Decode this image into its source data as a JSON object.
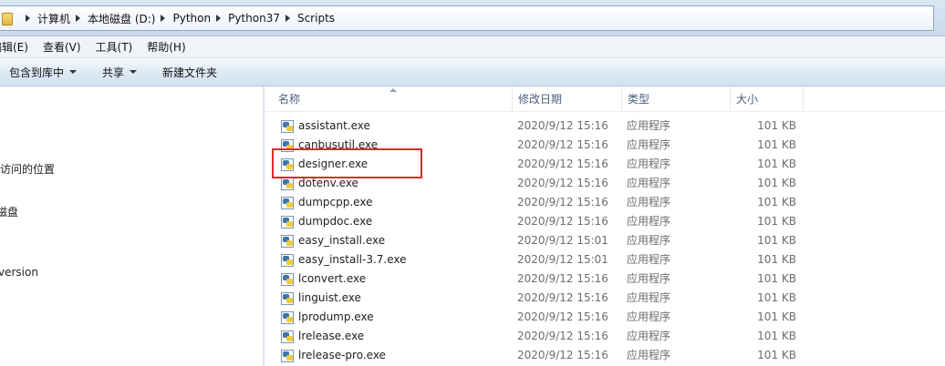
{
  "address": {
    "crumbs": [
      "计算机",
      "本地磁盘 (D:)",
      "Python",
      "Python37",
      "Scripts"
    ]
  },
  "menu": [
    "编辑(E)",
    "查看(V)",
    "工具(T)",
    "帮助(H)"
  ],
  "toolbar": {
    "include_library": "包含到库中",
    "share": "共享",
    "new_folder": "新建文件夹"
  },
  "nav": {
    "items": [
      "≡",
      "访问的位置",
      "磁盘",
      "version"
    ]
  },
  "columns": {
    "name": "名称",
    "date": "修改日期",
    "type": "类型",
    "size": "大小"
  },
  "files": [
    {
      "name": "assistant.exe",
      "date": "2020/9/12 15:16",
      "type": "应用程序",
      "size": "101 KB"
    },
    {
      "name": "canbusutil.exe",
      "date": "2020/9/12 15:16",
      "type": "应用程序",
      "size": "101 KB"
    },
    {
      "name": "designer.exe",
      "date": "2020/9/12 15:16",
      "type": "应用程序",
      "size": "101 KB"
    },
    {
      "name": "dotenv.exe",
      "date": "2020/9/12 15:16",
      "type": "应用程序",
      "size": "101 KB"
    },
    {
      "name": "dumpcpp.exe",
      "date": "2020/9/12 15:16",
      "type": "应用程序",
      "size": "101 KB"
    },
    {
      "name": "dumpdoc.exe",
      "date": "2020/9/12 15:16",
      "type": "应用程序",
      "size": "101 KB"
    },
    {
      "name": "easy_install.exe",
      "date": "2020/9/12 15:01",
      "type": "应用程序",
      "size": "101 KB"
    },
    {
      "name": "easy_install-3.7.exe",
      "date": "2020/9/12 15:01",
      "type": "应用程序",
      "size": "101 KB"
    },
    {
      "name": "lconvert.exe",
      "date": "2020/9/12 15:16",
      "type": "应用程序",
      "size": "101 KB"
    },
    {
      "name": "linguist.exe",
      "date": "2020/9/12 15:16",
      "type": "应用程序",
      "size": "101 KB"
    },
    {
      "name": "lprodump.exe",
      "date": "2020/9/12 15:16",
      "type": "应用程序",
      "size": "101 KB"
    },
    {
      "name": "lrelease.exe",
      "date": "2020/9/12 15:16",
      "type": "应用程序",
      "size": "101 KB"
    },
    {
      "name": "lrelease-pro.exe",
      "date": "2020/9/12 15:16",
      "type": "应用程序",
      "size": "101 KB"
    }
  ],
  "colors": {
    "highlight": "#e1272b",
    "header_text": "#4c607a",
    "meta_text": "#6d6d6d"
  }
}
